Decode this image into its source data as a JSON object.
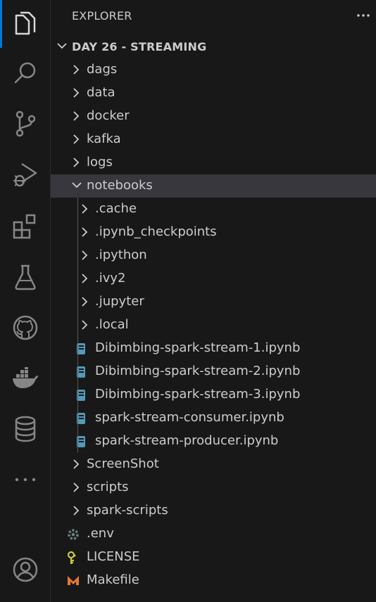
{
  "explorer": {
    "title": "EXPLORER",
    "section_title": "DAY 26 - STREAMING"
  },
  "activity_bar": {
    "items": [
      "explorer-icon",
      "search-icon",
      "source-control-icon",
      "run-debug-icon",
      "extensions-icon",
      "testing-icon",
      "github-icon",
      "docker-icon",
      "database-icon",
      "more-icon",
      "account-icon"
    ],
    "accent": "#0078d4"
  },
  "tree": [
    {
      "label": "dags",
      "type": "folder"
    },
    {
      "label": "data",
      "type": "folder"
    },
    {
      "label": "docker",
      "type": "folder"
    },
    {
      "label": "kafka",
      "type": "folder"
    },
    {
      "label": "logs",
      "type": "folder"
    },
    {
      "label": "notebooks",
      "type": "folder",
      "expanded": true,
      "selected": true
    },
    {
      "label": ".cache",
      "type": "folder"
    },
    {
      "label": ".ipynb_checkpoints",
      "type": "folder"
    },
    {
      "label": ".ipython",
      "type": "folder"
    },
    {
      "label": ".ivy2",
      "type": "folder"
    },
    {
      "label": ".jupyter",
      "type": "folder"
    },
    {
      "label": ".local",
      "type": "folder"
    },
    {
      "label": "Dibimbing-spark-stream-1.ipynb",
      "type": "notebook"
    },
    {
      "label": "Dibimbing-spark-stream-2.ipynb",
      "type": "notebook"
    },
    {
      "label": "Dibimbing-spark-stream-3.ipynb",
      "type": "notebook"
    },
    {
      "label": "spark-stream-consumer.ipynb",
      "type": "notebook"
    },
    {
      "label": "spark-stream-producer.ipynb",
      "type": "notebook"
    },
    {
      "label": "ScreenShot",
      "type": "folder"
    },
    {
      "label": "scripts",
      "type": "folder"
    },
    {
      "label": "spark-scripts",
      "type": "folder"
    },
    {
      "label": ".env",
      "type": "env"
    },
    {
      "label": "LICENSE",
      "type": "license"
    },
    {
      "label": "Makefile",
      "type": "makefile"
    }
  ],
  "colors": {
    "background": "#181818",
    "selected_row": "#37373d",
    "notebook_icon": "#519aba",
    "license_icon": "#cbcb41",
    "makefile_icon": "#e37933",
    "env_icon": "#6d8086"
  }
}
